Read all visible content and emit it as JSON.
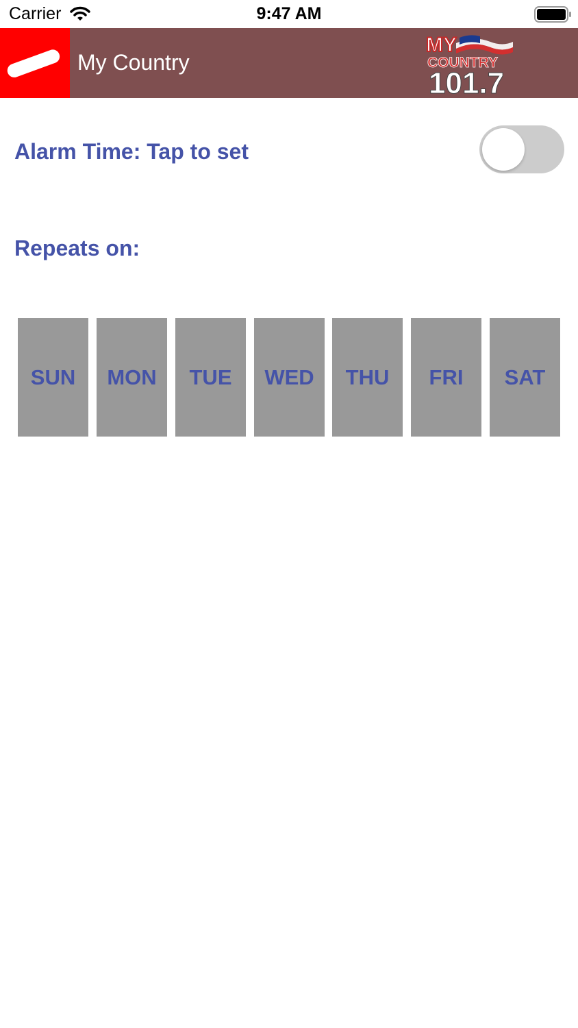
{
  "status_bar": {
    "carrier": "Carrier",
    "time": "9:47 AM"
  },
  "header": {
    "title": "My Country",
    "background_color": "#7f4f50",
    "menu_button_color": "#ff0000",
    "logo": {
      "line1": "MY",
      "line2": "COUNTRY",
      "line3": "101.7"
    }
  },
  "alarm": {
    "label": "Alarm Time: Tap to set",
    "enabled": false
  },
  "repeats": {
    "label": "Repeats on:",
    "days": [
      "SUN",
      "MON",
      "TUE",
      "WED",
      "THU",
      "FRI",
      "SAT"
    ]
  },
  "colors": {
    "label_text": "#4553a8",
    "day_button_bg": "#999999",
    "toggle_off": "#cccccc"
  }
}
